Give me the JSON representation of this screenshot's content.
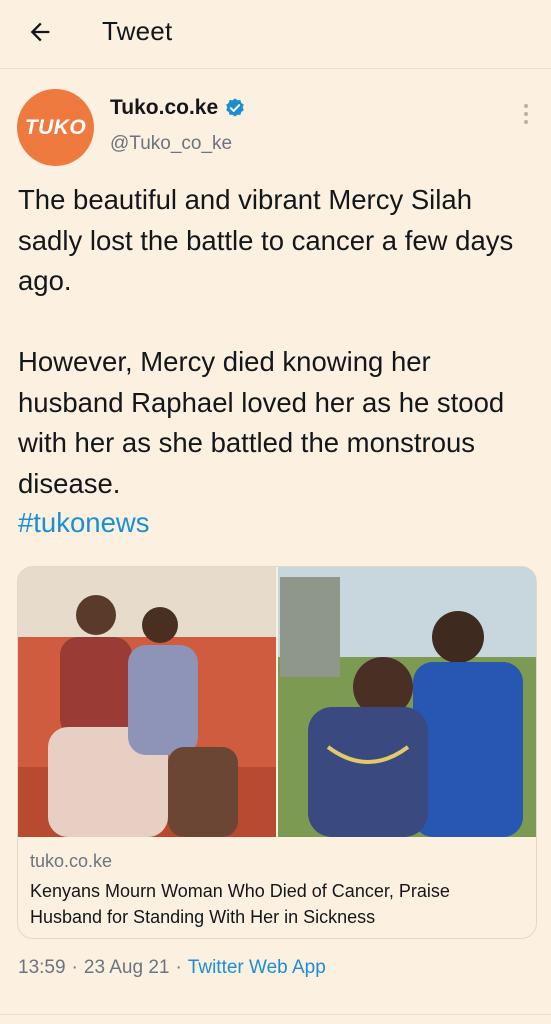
{
  "header": {
    "title": "Tweet",
    "back_icon": "arrow-left-icon"
  },
  "author": {
    "avatar_text": "TUKO",
    "avatar_color": "#ee7a3f",
    "name": "Tuko.co.ke",
    "handle": "@Tuko_co_ke",
    "verified": true,
    "verified_icon": "verified-badge-icon",
    "more_icon": "more-vertical-icon"
  },
  "tweet": {
    "text": "The beautiful and vibrant Mercy Silah sadly lost the battle to cancer a few days ago.\n\nHowever, Mercy died knowing her husband Raphael loved her as he stood with her as she battled the monstrous disease.",
    "hashtag": "#tukonews"
  },
  "card": {
    "domain": "tuko.co.ke",
    "title": "Kenyans Mourn Woman Who Died of Cancer, Praise Husband for Standing With Her in Sickness"
  },
  "meta": {
    "time": "13:59",
    "date": "23 Aug 21",
    "separator": "·",
    "source": "Twitter Web App"
  },
  "colors": {
    "background": "#fcf0e1",
    "link": "#1a8fd2",
    "secondary_text": "#6b7480",
    "avatar": "#ee7a3f"
  }
}
